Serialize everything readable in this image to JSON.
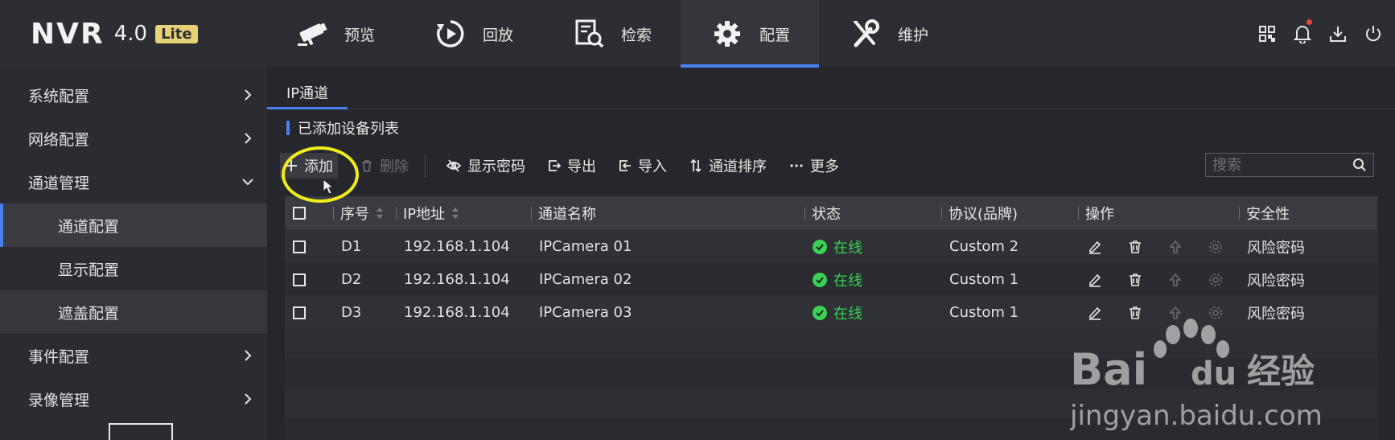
{
  "app": {
    "logo_name": "NVR",
    "logo_version": "4.0",
    "logo_edition": "Lite"
  },
  "nav": [
    {
      "label": "预览",
      "icon": "camera-icon"
    },
    {
      "label": "回放",
      "icon": "playback-icon"
    },
    {
      "label": "检索",
      "icon": "search-doc-icon"
    },
    {
      "label": "配置",
      "icon": "gear-icon",
      "active": true
    },
    {
      "label": "维护",
      "icon": "tools-icon"
    }
  ],
  "top_tools": [
    "qr-code-icon",
    "bell-icon",
    "download-icon",
    "power-icon"
  ],
  "sidebar": {
    "items": [
      {
        "label": "系统配置"
      },
      {
        "label": "网络配置"
      },
      {
        "label": "通道管理"
      },
      {
        "label": "通道配置",
        "active": true
      },
      {
        "label": "显示配置"
      },
      {
        "label": "遮盖配置"
      },
      {
        "label": "事件配置"
      },
      {
        "label": "录像管理"
      }
    ]
  },
  "tab": {
    "label": "IP通道"
  },
  "section": {
    "title": "已添加设备列表"
  },
  "toolbar": {
    "add": "添加",
    "delete": "删除",
    "show_password": "显示密码",
    "export": "导出",
    "import": "导入",
    "channel_sort": "通道排序",
    "more": "更多"
  },
  "search": {
    "placeholder": "搜索"
  },
  "table": {
    "headers": {
      "index": "序号",
      "ip": "IP地址",
      "name": "通道名称",
      "status": "状态",
      "protocol": "协议(品牌)",
      "ops": "操作",
      "security": "安全性"
    },
    "rows": [
      {
        "index": "D1",
        "ip": "192.168.1.104",
        "name": "IPCamera 01",
        "status": "在线",
        "protocol": "Custom 2",
        "security": "风险密码"
      },
      {
        "index": "D2",
        "ip": "192.168.1.104",
        "name": "IPCamera 02",
        "status": "在线",
        "protocol": "Custom 1",
        "security": "风险密码"
      },
      {
        "index": "D3",
        "ip": "192.168.1.104",
        "name": "IPCamera 03",
        "status": "在线",
        "protocol": "Custom 1",
        "security": "风险密码"
      }
    ]
  },
  "colors": {
    "accent": "#4a7ff0",
    "online": "#3ad154",
    "highlight": "#f0ec1a"
  },
  "watermark": {
    "brand": "Bai",
    "brand2": "du",
    "cn": "经验",
    "url": "jingyan.baidu.com"
  }
}
